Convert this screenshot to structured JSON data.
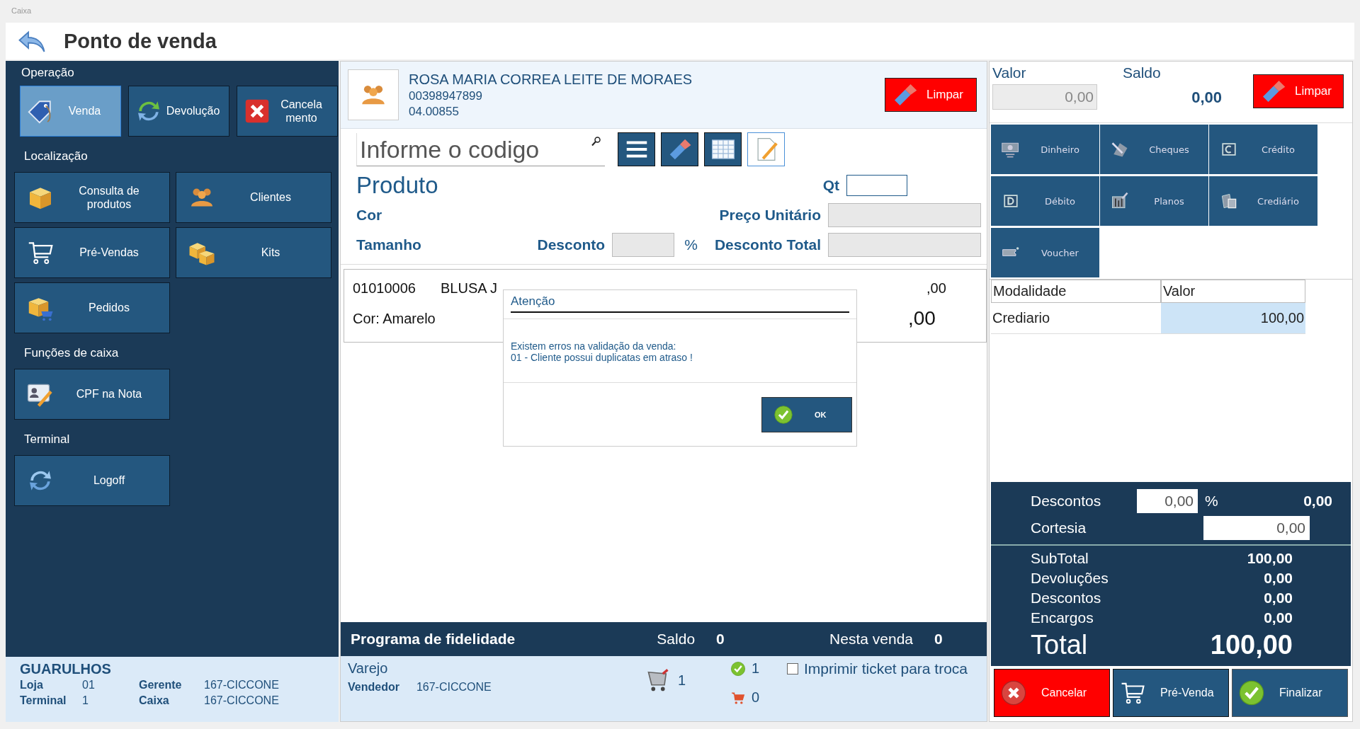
{
  "window": {
    "title": "Caixa"
  },
  "header": {
    "title": "Ponto de venda"
  },
  "sidebar": {
    "sections": [
      {
        "title": "Operação",
        "buttons": [
          {
            "label": "Venda",
            "selected": true
          },
          {
            "label": "Devolução",
            "selected": false
          },
          {
            "label": "Cancela\nmento",
            "selected": false
          }
        ]
      },
      {
        "title": "Localização",
        "buttons": [
          {
            "label": "Consulta de\nprodutos"
          },
          {
            "label": "Clientes"
          },
          {
            "label": "Pré-Vendas"
          },
          {
            "label": "Kits"
          },
          {
            "label": "Pedidos"
          }
        ]
      },
      {
        "title": "Funções de caixa",
        "buttons": [
          {
            "label": "CPF na Nota"
          }
        ]
      },
      {
        "title": "Terminal",
        "buttons": [
          {
            "label": "Logoff"
          }
        ]
      }
    ]
  },
  "store_info": {
    "name": "GUARULHOS",
    "fields": [
      {
        "label": "Loja",
        "value": "01"
      },
      {
        "label": "Gerente",
        "value": "167-CICCONE"
      },
      {
        "label": "Terminal",
        "value": "1"
      },
      {
        "label": "Caixa",
        "value": "167-CICCONE"
      }
    ]
  },
  "customer": {
    "name": "ROSA MARIA CORREA LEITE DE MORAES",
    "document": "00398947899",
    "code": "04.00855",
    "clear_button": "Limpar"
  },
  "product_search": {
    "placeholder": "Informe o codigo"
  },
  "product_form": {
    "title": "Produto",
    "qty_label": "Qt",
    "color_label": "Cor",
    "unit_price_label": "Preço Unitário",
    "size_label": "Tamanho",
    "discount_label": "Desconto",
    "percent": "%",
    "total_discount_label": "Desconto Total"
  },
  "items": [
    {
      "code": "01010006",
      "description": "BLUSA J",
      "price": ",00",
      "variant": "Cor: Amarelo",
      "total": ",00"
    }
  ],
  "dialog": {
    "title": "Atenção",
    "message_lines": [
      "Existem erros na validação da venda:",
      "01 - Cliente possui duplicatas em atraso !"
    ],
    "ok_button": "OK"
  },
  "loyalty": {
    "title": "Programa de fidelidade",
    "balance_label": "Saldo",
    "balance": "0",
    "this_sale_label": "Nesta venda",
    "this_sale": "0"
  },
  "sale_info": {
    "type": "Varejo",
    "seller_label": "Vendedor",
    "seller": "167-CICCONE",
    "cart_count": "1",
    "ok_count": "1",
    "red_cart_count": "0",
    "print_ticket": {
      "label": "Imprimir ticket para troca",
      "checked": false
    }
  },
  "payment": {
    "value_label": "Valor",
    "placeholder": "0,00",
    "balance_label": "Saldo",
    "balance": "0,00",
    "clear_button": "Limpar",
    "methods": [
      "Dinheiro",
      "Cheques",
      "Crédito",
      "Débito",
      "Planos",
      "Crediário",
      "Voucher"
    ],
    "table": {
      "columns": [
        "Modalidade",
        "Valor"
      ],
      "rows": [
        {
          "modalidade": "Crediario",
          "valor": "100,00",
          "selected": true
        }
      ]
    }
  },
  "totals": {
    "discount_label": "Descontos",
    "discount_percent": "0,00",
    "percent": "%",
    "discount_value": "0,00",
    "courtesy_label": "Cortesia",
    "courtesy": "0,00",
    "lines": [
      {
        "label": "SubTotal",
        "value": "100,00"
      },
      {
        "label": "Devoluções",
        "value": "0,00"
      },
      {
        "label": "Descontos",
        "value": "0,00"
      },
      {
        "label": "Encargos",
        "value": "0,00"
      }
    ],
    "total_label": "Total",
    "total": "100,00"
  },
  "actions": [
    {
      "kind": "cancel",
      "label": "Cancelar"
    },
    {
      "kind": "prevenda",
      "label": "Pré-Venda"
    },
    {
      "kind": "finish",
      "label": "Finalizar"
    }
  ]
}
